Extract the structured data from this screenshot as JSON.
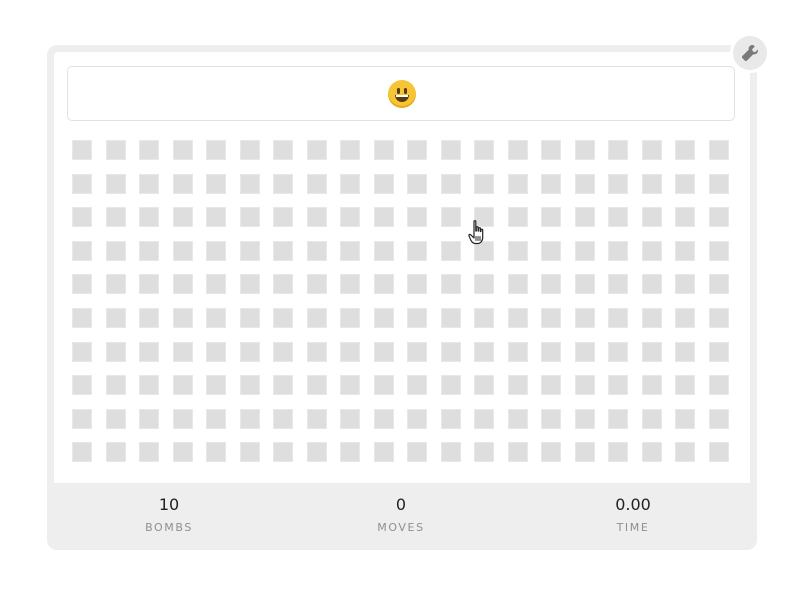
{
  "game": {
    "status_face": "smiley-face-icon",
    "rows": 10,
    "columns": 20,
    "cell_state": "unrevealed",
    "cell_color": "#dedede"
  },
  "stats": {
    "bombs": {
      "value": "10",
      "label": "BOMBS"
    },
    "moves": {
      "value": "0",
      "label": "MOVES"
    },
    "time": {
      "value": "0.00",
      "label": "TIME"
    }
  },
  "controls": {
    "settings_icon": "wrench-icon"
  },
  "colors": {
    "frame": "#eeeeee",
    "board": "#ffffff",
    "face": "#f6c536",
    "label": "#8f8f8f"
  }
}
